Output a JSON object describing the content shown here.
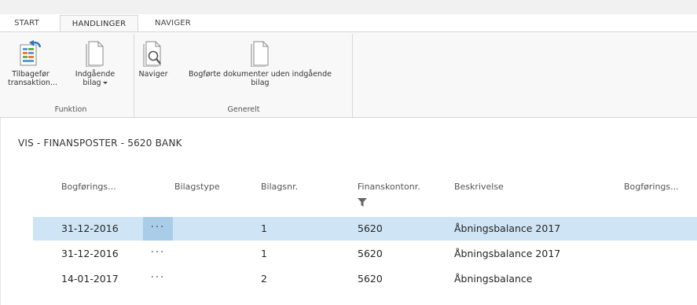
{
  "tabs": [
    {
      "label": "START"
    },
    {
      "label": "HANDLINGER"
    },
    {
      "label": "NAVIGER"
    }
  ],
  "ribbon": {
    "groups": [
      {
        "label": "Funktion",
        "buttons": [
          {
            "label_line1": "Tilbagefør",
            "label_line2": "transaktion...",
            "icon": "reverse-transaction-icon"
          },
          {
            "label_line1": "Indgående",
            "label_line2": "bilag",
            "icon": "document-icon",
            "has_dropdown": true
          }
        ]
      },
      {
        "label": "Generelt",
        "buttons": [
          {
            "label_line1": "Naviger",
            "label_line2": "",
            "icon": "document-magnifier-icon"
          },
          {
            "label_line1": "Bogførte dokumenter uden indgående",
            "label_line2": "bilag",
            "icon": "document-icon"
          }
        ]
      }
    ]
  },
  "page": {
    "title": "VIS - FINANSPOSTER - 5620 BANK"
  },
  "table": {
    "columns": [
      {
        "label": "Bogførings..."
      },
      {
        "label": "Bilagstype"
      },
      {
        "label": "Bilagsnr."
      },
      {
        "label": "Finanskontonr.",
        "filtered": true
      },
      {
        "label": "Beskrivelse"
      },
      {
        "label": "Bogførings..."
      }
    ],
    "rows": [
      {
        "date": "31-12-2016",
        "menu": "···",
        "doc_type": "",
        "doc_no": "1",
        "account": "5620",
        "description": "Åbningsbalance 2017",
        "selected": true
      },
      {
        "date": "31-12-2016",
        "menu": "···",
        "doc_type": "",
        "doc_no": "1",
        "account": "5620",
        "description": "Åbningsbalance 2017",
        "selected": false
      },
      {
        "date": "14-01-2017",
        "menu": "···",
        "doc_type": "",
        "doc_no": "2",
        "account": "5620",
        "description": "Åbningsbalance",
        "selected": false
      }
    ]
  },
  "colors": {
    "selected_row": "#cfe4f4",
    "selected_menu_cell": "#a9cde8",
    "ribbon_bg": "#f8f8f8",
    "icon_blue": "#2e75b6"
  }
}
